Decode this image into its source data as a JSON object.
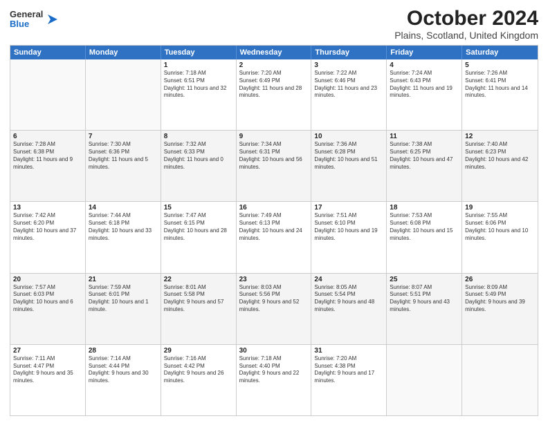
{
  "logo": {
    "general": "General",
    "blue": "Blue"
  },
  "title": {
    "month_year": "October 2024",
    "location": "Plains, Scotland, United Kingdom"
  },
  "header": {
    "days": [
      "Sunday",
      "Monday",
      "Tuesday",
      "Wednesday",
      "Thursday",
      "Friday",
      "Saturday"
    ]
  },
  "weeks": [
    [
      {
        "day": "",
        "empty": true
      },
      {
        "day": "",
        "empty": true
      },
      {
        "day": "1",
        "sunrise": "Sunrise: 7:18 AM",
        "sunset": "Sunset: 6:51 PM",
        "daylight": "Daylight: 11 hours and 32 minutes."
      },
      {
        "day": "2",
        "sunrise": "Sunrise: 7:20 AM",
        "sunset": "Sunset: 6:49 PM",
        "daylight": "Daylight: 11 hours and 28 minutes."
      },
      {
        "day": "3",
        "sunrise": "Sunrise: 7:22 AM",
        "sunset": "Sunset: 6:46 PM",
        "daylight": "Daylight: 11 hours and 23 minutes."
      },
      {
        "day": "4",
        "sunrise": "Sunrise: 7:24 AM",
        "sunset": "Sunset: 6:43 PM",
        "daylight": "Daylight: 11 hours and 19 minutes."
      },
      {
        "day": "5",
        "sunrise": "Sunrise: 7:26 AM",
        "sunset": "Sunset: 6:41 PM",
        "daylight": "Daylight: 11 hours and 14 minutes."
      }
    ],
    [
      {
        "day": "6",
        "sunrise": "Sunrise: 7:28 AM",
        "sunset": "Sunset: 6:38 PM",
        "daylight": "Daylight: 11 hours and 9 minutes."
      },
      {
        "day": "7",
        "sunrise": "Sunrise: 7:30 AM",
        "sunset": "Sunset: 6:36 PM",
        "daylight": "Daylight: 11 hours and 5 minutes."
      },
      {
        "day": "8",
        "sunrise": "Sunrise: 7:32 AM",
        "sunset": "Sunset: 6:33 PM",
        "daylight": "Daylight: 11 hours and 0 minutes."
      },
      {
        "day": "9",
        "sunrise": "Sunrise: 7:34 AM",
        "sunset": "Sunset: 6:31 PM",
        "daylight": "Daylight: 10 hours and 56 minutes."
      },
      {
        "day": "10",
        "sunrise": "Sunrise: 7:36 AM",
        "sunset": "Sunset: 6:28 PM",
        "daylight": "Daylight: 10 hours and 51 minutes."
      },
      {
        "day": "11",
        "sunrise": "Sunrise: 7:38 AM",
        "sunset": "Sunset: 6:25 PM",
        "daylight": "Daylight: 10 hours and 47 minutes."
      },
      {
        "day": "12",
        "sunrise": "Sunrise: 7:40 AM",
        "sunset": "Sunset: 6:23 PM",
        "daylight": "Daylight: 10 hours and 42 minutes."
      }
    ],
    [
      {
        "day": "13",
        "sunrise": "Sunrise: 7:42 AM",
        "sunset": "Sunset: 6:20 PM",
        "daylight": "Daylight: 10 hours and 37 minutes."
      },
      {
        "day": "14",
        "sunrise": "Sunrise: 7:44 AM",
        "sunset": "Sunset: 6:18 PM",
        "daylight": "Daylight: 10 hours and 33 minutes."
      },
      {
        "day": "15",
        "sunrise": "Sunrise: 7:47 AM",
        "sunset": "Sunset: 6:15 PM",
        "daylight": "Daylight: 10 hours and 28 minutes."
      },
      {
        "day": "16",
        "sunrise": "Sunrise: 7:49 AM",
        "sunset": "Sunset: 6:13 PM",
        "daylight": "Daylight: 10 hours and 24 minutes."
      },
      {
        "day": "17",
        "sunrise": "Sunrise: 7:51 AM",
        "sunset": "Sunset: 6:10 PM",
        "daylight": "Daylight: 10 hours and 19 minutes."
      },
      {
        "day": "18",
        "sunrise": "Sunrise: 7:53 AM",
        "sunset": "Sunset: 6:08 PM",
        "daylight": "Daylight: 10 hours and 15 minutes."
      },
      {
        "day": "19",
        "sunrise": "Sunrise: 7:55 AM",
        "sunset": "Sunset: 6:06 PM",
        "daylight": "Daylight: 10 hours and 10 minutes."
      }
    ],
    [
      {
        "day": "20",
        "sunrise": "Sunrise: 7:57 AM",
        "sunset": "Sunset: 6:03 PM",
        "daylight": "Daylight: 10 hours and 6 minutes."
      },
      {
        "day": "21",
        "sunrise": "Sunrise: 7:59 AM",
        "sunset": "Sunset: 6:01 PM",
        "daylight": "Daylight: 10 hours and 1 minute."
      },
      {
        "day": "22",
        "sunrise": "Sunrise: 8:01 AM",
        "sunset": "Sunset: 5:58 PM",
        "daylight": "Daylight: 9 hours and 57 minutes."
      },
      {
        "day": "23",
        "sunrise": "Sunrise: 8:03 AM",
        "sunset": "Sunset: 5:56 PM",
        "daylight": "Daylight: 9 hours and 52 minutes."
      },
      {
        "day": "24",
        "sunrise": "Sunrise: 8:05 AM",
        "sunset": "Sunset: 5:54 PM",
        "daylight": "Daylight: 9 hours and 48 minutes."
      },
      {
        "day": "25",
        "sunrise": "Sunrise: 8:07 AM",
        "sunset": "Sunset: 5:51 PM",
        "daylight": "Daylight: 9 hours and 43 minutes."
      },
      {
        "day": "26",
        "sunrise": "Sunrise: 8:09 AM",
        "sunset": "Sunset: 5:49 PM",
        "daylight": "Daylight: 9 hours and 39 minutes."
      }
    ],
    [
      {
        "day": "27",
        "sunrise": "Sunrise: 7:11 AM",
        "sunset": "Sunset: 4:47 PM",
        "daylight": "Daylight: 9 hours and 35 minutes."
      },
      {
        "day": "28",
        "sunrise": "Sunrise: 7:14 AM",
        "sunset": "Sunset: 4:44 PM",
        "daylight": "Daylight: 9 hours and 30 minutes."
      },
      {
        "day": "29",
        "sunrise": "Sunrise: 7:16 AM",
        "sunset": "Sunset: 4:42 PM",
        "daylight": "Daylight: 9 hours and 26 minutes."
      },
      {
        "day": "30",
        "sunrise": "Sunrise: 7:18 AM",
        "sunset": "Sunset: 4:40 PM",
        "daylight": "Daylight: 9 hours and 22 minutes."
      },
      {
        "day": "31",
        "sunrise": "Sunrise: 7:20 AM",
        "sunset": "Sunset: 4:38 PM",
        "daylight": "Daylight: 9 hours and 17 minutes."
      },
      {
        "day": "",
        "empty": true
      },
      {
        "day": "",
        "empty": true
      }
    ]
  ]
}
